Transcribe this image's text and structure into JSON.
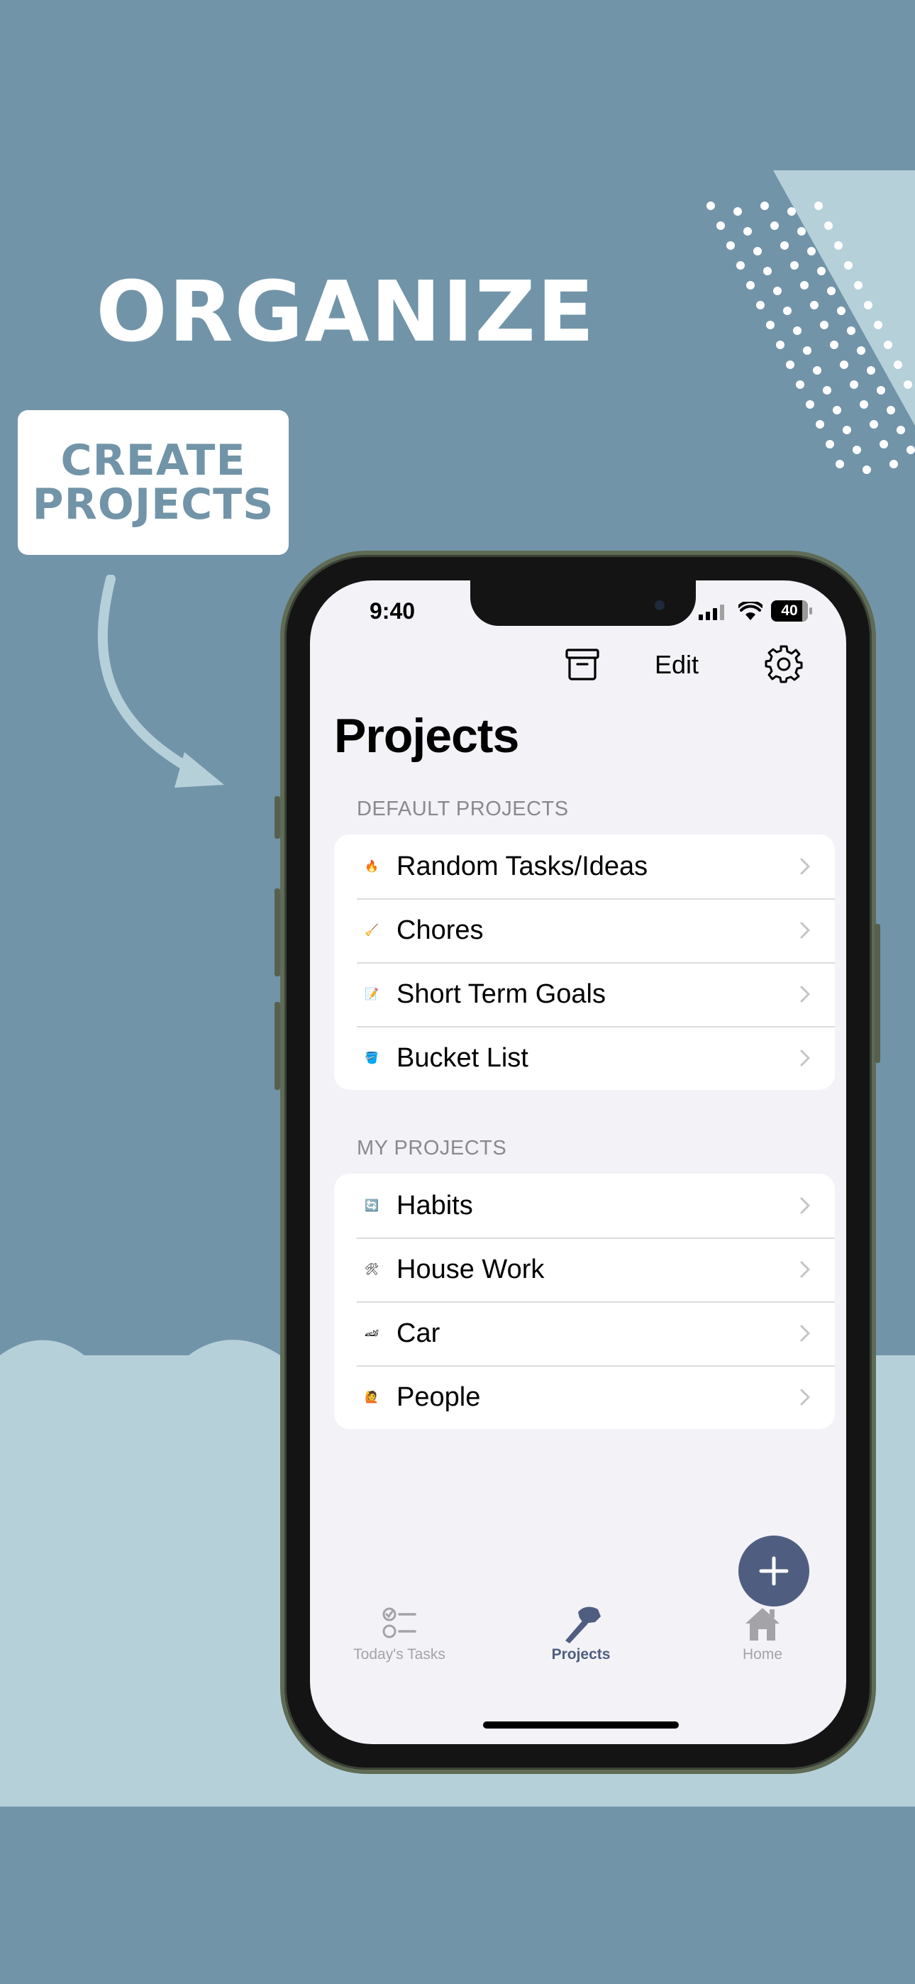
{
  "promo": {
    "headline": "ORGANIZE",
    "tag_line1": "CREATE",
    "tag_line2": "PROJECTS"
  },
  "colors": {
    "background": "#7294a8",
    "band": "#b6d0da",
    "fab": "#4f5e80",
    "tab_active": "#4f5e80",
    "tab_inactive": "#a3a3a8"
  },
  "status_bar": {
    "time": "9:40",
    "battery": "40"
  },
  "nav": {
    "edit_label": "Edit",
    "archive_icon": "archive-box-icon",
    "settings_icon": "gear-icon"
  },
  "page": {
    "title": "Projects"
  },
  "sections": [
    {
      "header": "DEFAULT PROJECTS",
      "items": [
        {
          "emoji": "🔥",
          "label": "Random Tasks/Ideas"
        },
        {
          "emoji": "🧹",
          "label": "Chores"
        },
        {
          "emoji": "📝",
          "label": "Short Term Goals"
        },
        {
          "emoji": "🪣",
          "label": "Bucket List"
        }
      ]
    },
    {
      "header": "MY PROJECTS",
      "items": [
        {
          "emoji": "🔄",
          "label": "Habits"
        },
        {
          "emoji": "🛠",
          "label": "House Work"
        },
        {
          "emoji": "🏎",
          "label": "Car"
        },
        {
          "emoji": "🙋",
          "label": "People"
        }
      ]
    }
  ],
  "tab_bar": {
    "items": [
      {
        "label": "Today's Tasks",
        "icon": "checklist-icon",
        "active": false
      },
      {
        "label": "Projects",
        "icon": "hammer-icon",
        "active": true
      },
      {
        "label": "Home",
        "icon": "house-icon",
        "active": false
      }
    ]
  }
}
